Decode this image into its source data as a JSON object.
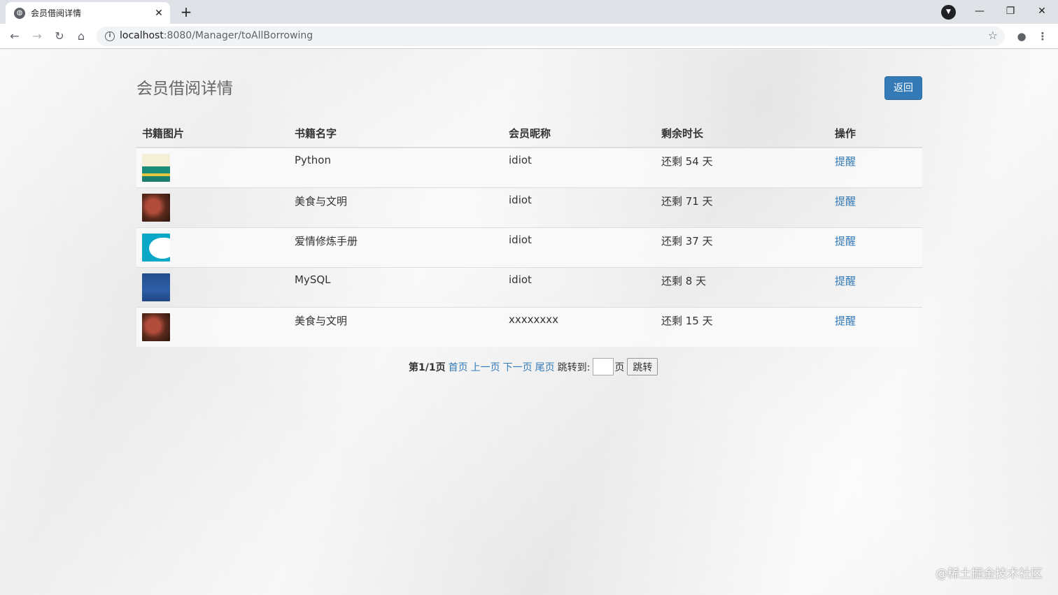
{
  "browser": {
    "tab_title": "会员借阅详情",
    "tab_close": "✕",
    "new_tab": "+",
    "url_host": "localhost",
    "url_rest": ":8080/Manager/toAllBorrowing",
    "icons": {
      "back": "arrow-left-icon",
      "forward": "arrow-right-icon",
      "reload": "reload-icon",
      "home": "home-icon",
      "info": "info-icon",
      "star": "star-icon",
      "account": "account-icon",
      "menu": "menu-icon"
    },
    "window_controls": {
      "minimize": "—",
      "restore": "❐",
      "close": "✕"
    }
  },
  "page": {
    "title": "会员借阅详情",
    "back_button": "返回",
    "table": {
      "headers": [
        "书籍图片",
        "书籍名字",
        "会员昵称",
        "剩余时长",
        "操作"
      ],
      "rows": [
        {
          "cover": "python",
          "book": "Python",
          "member": "idiot",
          "remaining": "还剩 54 天",
          "action": "提醒"
        },
        {
          "cover": "food",
          "book": "美食与文明",
          "member": "idiot",
          "remaining": "还剩 71 天",
          "action": "提醒"
        },
        {
          "cover": "love",
          "book": "爱情修炼手册",
          "member": "idiot",
          "remaining": "还剩 37 天",
          "action": "提醒"
        },
        {
          "cover": "mysql",
          "book": "MySQL",
          "member": "idiot",
          "remaining": "还剩 8 天",
          "action": "提醒"
        },
        {
          "cover": "food",
          "book": "美食与文明",
          "member": "xxxxxxxx",
          "remaining": "还剩 15 天",
          "action": "提醒"
        }
      ]
    },
    "pager": {
      "status": "第1/1页",
      "first": "首页",
      "prev": "上一页",
      "next": "下一页",
      "last": "尾页",
      "jump_label": "跳转到:",
      "jump_value": "",
      "page_unit": "页",
      "jump_button": "跳转"
    }
  },
  "watermark": "@稀土掘金技术社区",
  "colors": {
    "accent": "#337ab7",
    "link": "#337ab7"
  }
}
